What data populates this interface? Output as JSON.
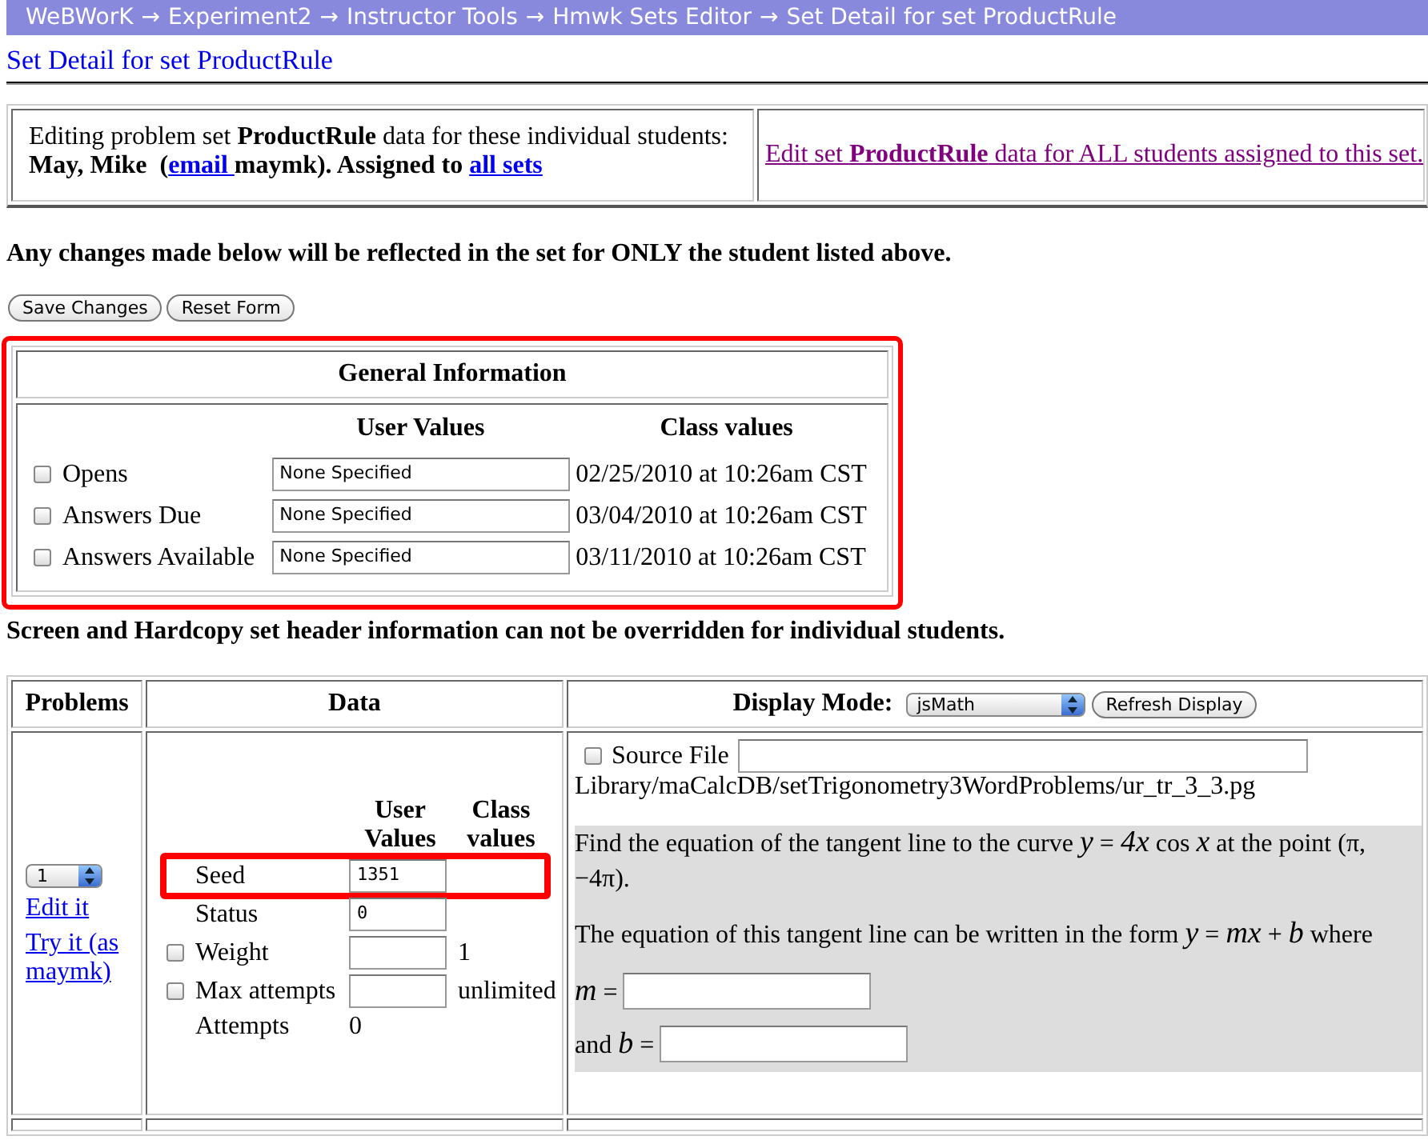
{
  "breadcrumb": {
    "separator": "→",
    "items": [
      "WeBWorK",
      "Experiment2",
      "Instructor Tools",
      "Hmwk Sets Editor",
      "Set Detail for set ProductRule"
    ]
  },
  "page_title": "Set Detail for set ProductRule",
  "editing_box": {
    "intro": "Editing problem set **ProductRule** data for these individual students:",
    "student_line": [
      {
        "kind": "text",
        "text": "May, Mike  ("
      },
      {
        "kind": "link",
        "text": "email "
      },
      {
        "kind": "text",
        "text": "maymk). Assigned to "
      },
      {
        "kind": "link",
        "text": "all sets"
      }
    ],
    "all_students_link": "Edit set **ProductRule** data for ALL students assigned to this set."
  },
  "notice": "Any changes made below will be reflected in the set for ONLY the student listed above.",
  "buttons": [
    "Save Changes",
    "Reset Form"
  ],
  "general_info": {
    "title": "General Information",
    "highlighted": true,
    "columns": [
      "User Values",
      "Class values"
    ],
    "rows": [
      {
        "label": "Opens",
        "checked": false,
        "value": "None Specified",
        "class_value": "02/25/2010 at 10:26am CST"
      },
      {
        "label": "Answers Due",
        "checked": false,
        "value": "None Specified",
        "class_value": "03/04/2010 at 10:26am CST"
      },
      {
        "label": "Answers Available",
        "checked": false,
        "value": "None Specified",
        "class_value": "03/11/2010 at 10:26am CST"
      }
    ]
  },
  "header_notice": "Screen and Hardcopy set header information can not be overridden for individual students.",
  "problems_table": {
    "columns": [
      "Problems",
      "Data"
    ],
    "display_mode": {
      "label": "Display Mode:",
      "value": "jsMath",
      "button": "Refresh Display"
    },
    "problem": {
      "number": "1",
      "links": [
        "Edit it",
        "Try it (as maymk)"
      ],
      "data_columns": [
        "User Values",
        "Class values"
      ],
      "fields": [
        {
          "kind": "input",
          "label": "Seed",
          "value": "1351",
          "highlighted": true
        },
        {
          "kind": "input",
          "label": "Status",
          "value": "0",
          "highlighted": false
        },
        {
          "kind": "checkinput",
          "label": "Weight",
          "checked": false,
          "class_value": "1",
          "highlighted": false
        },
        {
          "kind": "checkinput",
          "label": "Max attempts",
          "checked": false,
          "class_value": "unlimited",
          "highlighted": false
        },
        {
          "kind": "text",
          "label": "Attempts",
          "value": "0",
          "highlighted": false
        }
      ],
      "source_file": {
        "label": "Source File",
        "checked": false,
        "path": "Library/maCalcDB/setTrigonometry3WordProblems/ur_tr_3_3.pg"
      },
      "question": {
        "paragraphs": [
          "Find the equation of the tangent line to the curve *y* = *4x* cos *x* at the point (π, −4π).",
          "The equation of this tangent line can be written in the form *y* = *mx* + *b* where"
        ],
        "answers": [
          {
            "label": "*m* ="
          },
          {
            "label": "and *b* ="
          }
        ]
      }
    }
  }
}
